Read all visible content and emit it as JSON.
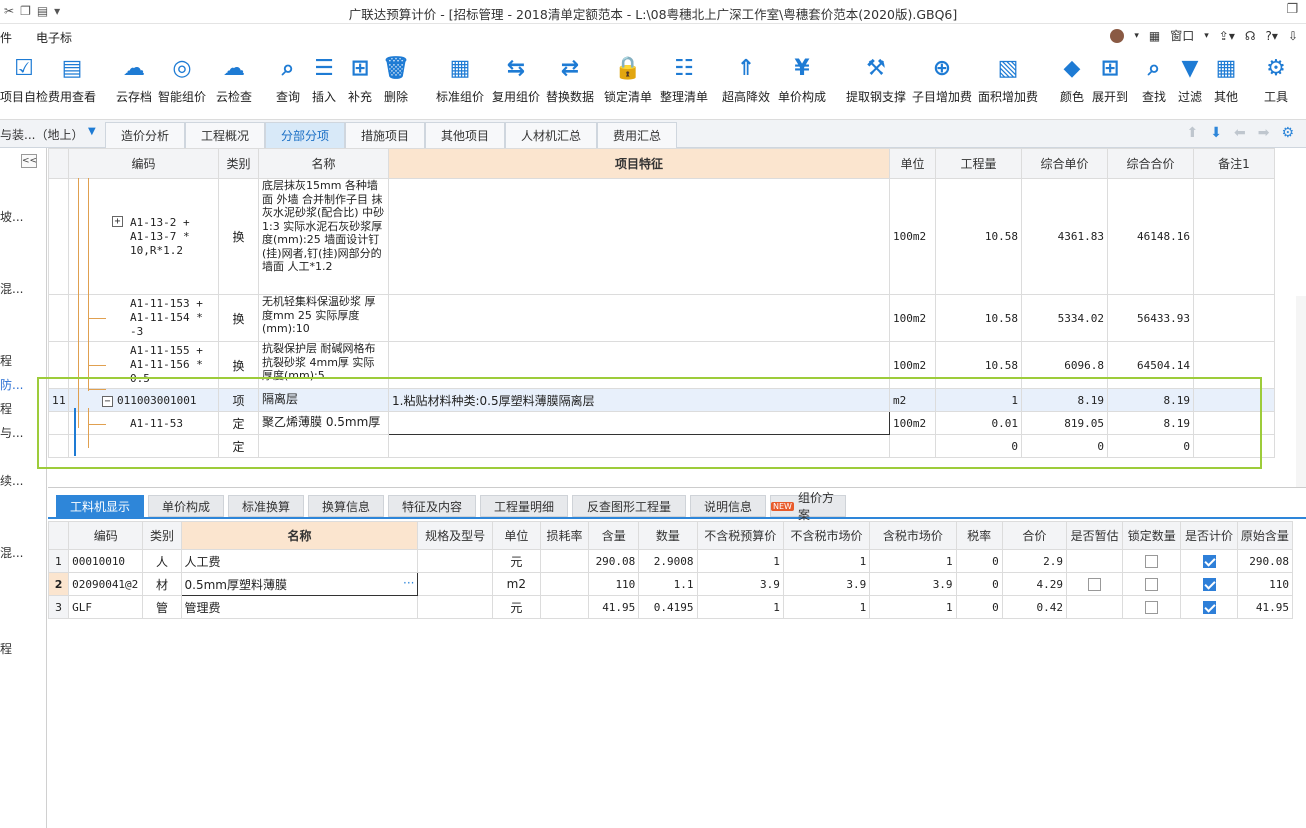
{
  "titlebar": {
    "title": "广联达预算计价 - [招标管理 - 2018清单定额范本 - L:\\08粤穗北上广深工作室\\粤穗套价范本(2020版).GBQ6]",
    "quick_icons": [
      "scissors-icon",
      "copy-icon",
      "paste-icon"
    ],
    "window_controls": [
      "restore-icon"
    ]
  },
  "menubar": {
    "left_items": [
      "件",
      "电子标"
    ],
    "window_label": "窗口",
    "avatar": "user-avatar"
  },
  "toolbar": {
    "buttons": [
      {
        "label": "项目自检",
        "icon": "check-icon"
      },
      {
        "label": "费用查看",
        "icon": "view-fee-icon"
      },
      {
        "label": "云存档",
        "icon": "cloud-upload-icon"
      },
      {
        "label": "智能组价",
        "icon": "smart-price-icon"
      },
      {
        "label": "云检查",
        "icon": "cloud-check-icon"
      },
      {
        "label": "查询",
        "icon": "query-icon"
      },
      {
        "label": "插入",
        "icon": "insert-icon"
      },
      {
        "label": "补充",
        "icon": "supplement-icon"
      },
      {
        "label": "删除",
        "icon": "delete-icon"
      },
      {
        "label": "标准组价",
        "icon": "standard-price-icon"
      },
      {
        "label": "复用组价",
        "icon": "reuse-price-icon"
      },
      {
        "label": "替换数据",
        "icon": "replace-data-icon"
      },
      {
        "label": "锁定清单",
        "icon": "lock-icon"
      },
      {
        "label": "整理清单",
        "icon": "organize-icon"
      },
      {
        "label": "超高降效",
        "icon": "height-icon"
      },
      {
        "label": "单价构成",
        "icon": "unit-price-icon"
      },
      {
        "label": "提取钢支撑",
        "icon": "steel-support-icon"
      },
      {
        "label": "子目增加费",
        "icon": "sub-item-fee-icon"
      },
      {
        "label": "面积增加费",
        "icon": "area-fee-icon"
      },
      {
        "label": "颜色",
        "icon": "color-icon"
      },
      {
        "label": "展开到",
        "icon": "expand-icon"
      },
      {
        "label": "查找",
        "icon": "find-icon"
      },
      {
        "label": "过滤",
        "icon": "filter-icon"
      },
      {
        "label": "其他",
        "icon": "other-icon"
      },
      {
        "label": "工具",
        "icon": "tools-icon"
      }
    ]
  },
  "tabs": {
    "side_label": "与装...（地上）",
    "items": [
      "造价分析",
      "工程概况",
      "分部分项",
      "措施项目",
      "其他项目",
      "人材机汇总",
      "费用汇总"
    ],
    "active": "分部分项"
  },
  "left_panel": {
    "items": [
      "坡...",
      "混...",
      "程",
      "防...",
      "程",
      "与...",
      "续...",
      "混...",
      "程"
    ]
  },
  "main_table": {
    "headers": [
      "编码",
      "类别",
      "名称",
      "项目特征",
      "单位",
      "工程量",
      "综合单价",
      "综合合价",
      "备注1"
    ],
    "rows": [
      {
        "num": "",
        "code": "A1-13-2 + A1-13-7 * 10,R*1.2",
        "type": "换",
        "name": "底层抹灰15mm 各种墙面 外墙 合并制作子目 抹灰水泥砂浆(配合比) 中砂 1:3 实际水泥石灰砂浆厚度(mm):25 墙面设计钉(挂)网者,钉(挂)网部分的墙面 人工*1.2",
        "feature": "",
        "unit": "100m2",
        "qty": "10.58",
        "price": "4361.83",
        "total": "46148.16",
        "remark": ""
      },
      {
        "num": "",
        "code": "A1-11-153 + A1-11-154 * -3",
        "type": "换",
        "name": "无机轻集料保温砂浆 厚度mm 25 实际厚度(mm):10",
        "feature": "",
        "unit": "100m2",
        "qty": "10.58",
        "price": "5334.02",
        "total": "56433.93",
        "remark": ""
      },
      {
        "num": "",
        "code": "A1-11-155 + A1-11-156 * 0.5",
        "type": "换",
        "name": "抗裂保护层 耐碱网格布抗裂砂浆 4mm厚 实际厚度(mm):5",
        "feature": "",
        "unit": "100m2",
        "qty": "10.58",
        "price": "6096.8",
        "total": "64504.14",
        "remark": ""
      },
      {
        "num": "11",
        "code": "011003001001",
        "type": "项",
        "name": "隔离层",
        "feature": "1.粘贴材料种类:0.5厚塑料薄膜隔离层",
        "unit": "m2",
        "qty": "1",
        "price": "8.19",
        "total": "8.19",
        "remark": ""
      },
      {
        "num": "",
        "code": "A1-11-53",
        "type": "定",
        "name": "聚乙烯薄膜 0.5mm厚",
        "feature": "",
        "unit": "100m2",
        "qty": "0.01",
        "price": "819.05",
        "total": "8.19",
        "remark": ""
      },
      {
        "num": "",
        "code": "",
        "type": "定",
        "name": "",
        "feature": "",
        "unit": "",
        "qty": "0",
        "price": "0",
        "total": "0",
        "remark": ""
      }
    ]
  },
  "bottom_tabs": {
    "items": [
      "工料机显示",
      "单价构成",
      "标准换算",
      "换算信息",
      "特征及内容",
      "工程量明细",
      "反查图形工程量",
      "说明信息",
      "组价方案"
    ],
    "active": "工料机显示",
    "new_badge": "NEW"
  },
  "resource_table": {
    "headers": [
      "编码",
      "类别",
      "名称",
      "规格及型号",
      "单位",
      "损耗率",
      "含量",
      "数量",
      "不含税预算价",
      "不含税市场价",
      "含税市场价",
      "税率",
      "合价",
      "是否暂估",
      "锁定数量",
      "是否计价",
      "原始含量"
    ],
    "rows": [
      {
        "num": "1",
        "code": "00010010",
        "type": "人",
        "name": "人工费",
        "spec": "",
        "unit": "元",
        "loss": "",
        "content": "290.08",
        "qty": "2.9008",
        "pre": "1",
        "mkt": "1",
        "mkt_tax": "1",
        "tax": "0",
        "total": "2.9",
        "est": false,
        "lock": false,
        "priced": true,
        "orig": "290.08"
      },
      {
        "num": "2",
        "code": "02090041@2",
        "type": "材",
        "name": "0.5mm厚塑料薄膜",
        "spec": "",
        "unit": "m2",
        "loss": "",
        "content": "110",
        "qty": "1.1",
        "pre": "3.9",
        "mkt": "3.9",
        "mkt_tax": "3.9",
        "tax": "0",
        "total": "4.29",
        "est": false,
        "lock": false,
        "priced": true,
        "orig": "110"
      },
      {
        "num": "3",
        "code": "GLF",
        "type": "管",
        "name": "管理费",
        "spec": "",
        "unit": "元",
        "loss": "",
        "content": "41.95",
        "qty": "0.4195",
        "pre": "1",
        "mkt": "1",
        "mkt_tax": "1",
        "tax": "0",
        "total": "0.42",
        "est": false,
        "lock": false,
        "priced": true,
        "orig": "41.95"
      }
    ]
  },
  "colors": {
    "accent": "#2e86d9",
    "highlight": "#fbe5cf",
    "green_outline": "#9dcc3a"
  }
}
